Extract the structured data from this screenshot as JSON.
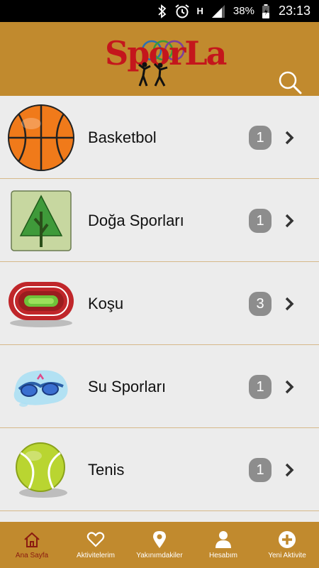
{
  "status_bar": {
    "battery": "38%",
    "time": "23:13",
    "network_type": "H",
    "icons": [
      "bluetooth-icon",
      "alarm-icon",
      "signal-icon",
      "battery-icon"
    ]
  },
  "header": {
    "logo_text": "SporLa",
    "background_color": "#c18a2e",
    "search_icon": "search-icon"
  },
  "categories": [
    {
      "label": "Basketbol",
      "count": "1",
      "icon": "basketball-icon"
    },
    {
      "label": "Doğa Sporları",
      "count": "1",
      "icon": "tree-icon"
    },
    {
      "label": "Koşu",
      "count": "3",
      "icon": "running-track-icon"
    },
    {
      "label": "Su Sporları",
      "count": "1",
      "icon": "swim-goggles-icon"
    },
    {
      "label": "Tenis",
      "count": "1",
      "icon": "tennis-ball-icon"
    }
  ],
  "bottom_nav": {
    "active_color": "#8a1a10",
    "items": [
      {
        "label": "Ana Sayfa",
        "icon": "home-icon",
        "active": true
      },
      {
        "label": "Aktivitelerim",
        "icon": "heart-icon",
        "active": false
      },
      {
        "label": "Yakınımdakiler",
        "icon": "location-pin-icon",
        "active": false
      },
      {
        "label": "Hesabım",
        "icon": "user-icon",
        "active": false
      },
      {
        "label": "Yeni Aktivite",
        "icon": "plus-circle-icon",
        "active": false
      }
    ]
  }
}
